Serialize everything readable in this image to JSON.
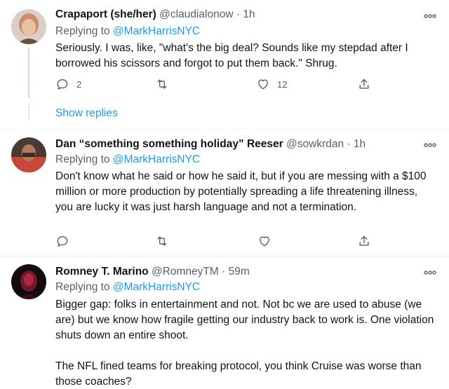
{
  "tweets": [
    {
      "name": "Crapaport (she/her)",
      "handle": "@claudialonow",
      "separator": "·",
      "time": "1h",
      "replying_prefix": "Replying to ",
      "replying_to": "@MarkHarrisNYC",
      "text": "Seriously. I was, like, \"what's the big deal? Sounds like my stepdad after I borrowed his scissors and forgot to put them back.\" Shrug.",
      "reply_count": "2",
      "retweet_count": "",
      "like_count": "12",
      "show_replies": "Show replies",
      "avatar_colors": [
        "#c9a48a",
        "#e8c9a6",
        "#7a5a48"
      ]
    },
    {
      "name": "Dan “something something holiday” Reeser",
      "handle": "@sowkrdan",
      "separator": "·",
      "time": "1h",
      "replying_prefix": "Replying to ",
      "replying_to": "@MarkHarrisNYC",
      "text": "Don't know what he said or how he said it, but if you are messing with a $100 million or more production by potentially spreading a life threatening illness, you are lucky it was just harsh language and not a termination.",
      "reply_count": "",
      "retweet_count": "",
      "like_count": "",
      "avatar_colors": [
        "#9b6a4e",
        "#d86b4a",
        "#3a2d2a"
      ]
    },
    {
      "name": "Romney T. Marino",
      "handle": "@RomneyTM",
      "separator": "·",
      "time": "59m",
      "replying_prefix": "Replying to ",
      "replying_to": "@MarkHarrisNYC",
      "text": "Bigger gap: folks in entertainment and not. Not bc we are used to abuse (we are) but we know how fragile getting our industry back to work is. One violation shuts down an entire shoot.\n\nThe NFL fined teams for breaking protocol, you think Cruise was worse than those coaches?",
      "avatar_colors": [
        "#1a0f10",
        "#b0203a",
        "#5a1020"
      ]
    }
  ],
  "icons": {
    "reply": "reply-icon",
    "retweet": "retweet-icon",
    "like": "like-icon",
    "share": "share-icon",
    "more": "more-icon"
  },
  "accent_color": "#1d9bf0"
}
